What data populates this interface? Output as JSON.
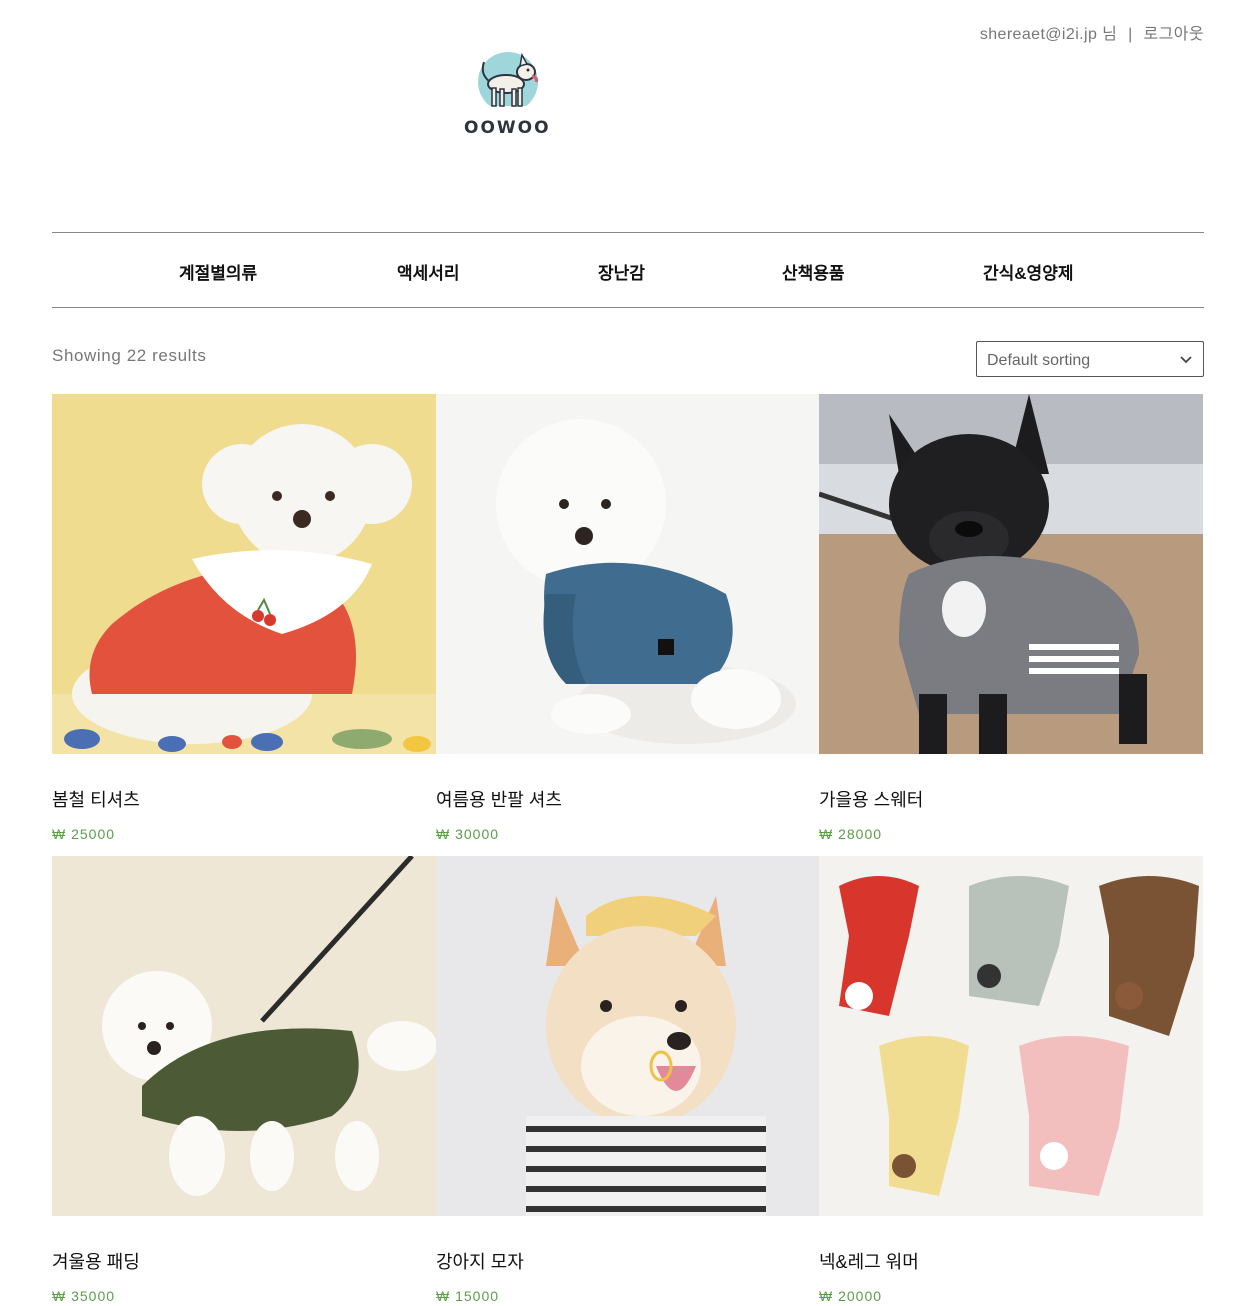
{
  "header": {
    "user_email": "shereaet@i2i.jp",
    "user_suffix": "님",
    "separator": "|",
    "logout_label": "로그아웃",
    "logo_text": "OOWOO"
  },
  "nav": {
    "items": [
      {
        "label": "계절별의류"
      },
      {
        "label": "액세서리"
      },
      {
        "label": "장난감"
      },
      {
        "label": "산책용품"
      },
      {
        "label": "간식&영양제"
      }
    ]
  },
  "shop": {
    "result_count": "Showing 22 results",
    "sorting": {
      "selected": "Default sorting"
    }
  },
  "products": [
    {
      "title": "봄철 티셔츠",
      "price": "₩ 25000"
    },
    {
      "title": "여름용 반팔 셔츠",
      "price": "₩ 30000"
    },
    {
      "title": "가을용 스웨터",
      "price": "₩ 28000"
    },
    {
      "title": "겨울용 패딩",
      "price": "₩ 35000"
    },
    {
      "title": "강아지 모자",
      "price": "₩ 15000"
    },
    {
      "title": "넥&레그 워머",
      "price": "₩ 20000"
    }
  ],
  "colors": {
    "price": "#5a9e48",
    "muted_text": "#777777",
    "divider": "#888888"
  }
}
